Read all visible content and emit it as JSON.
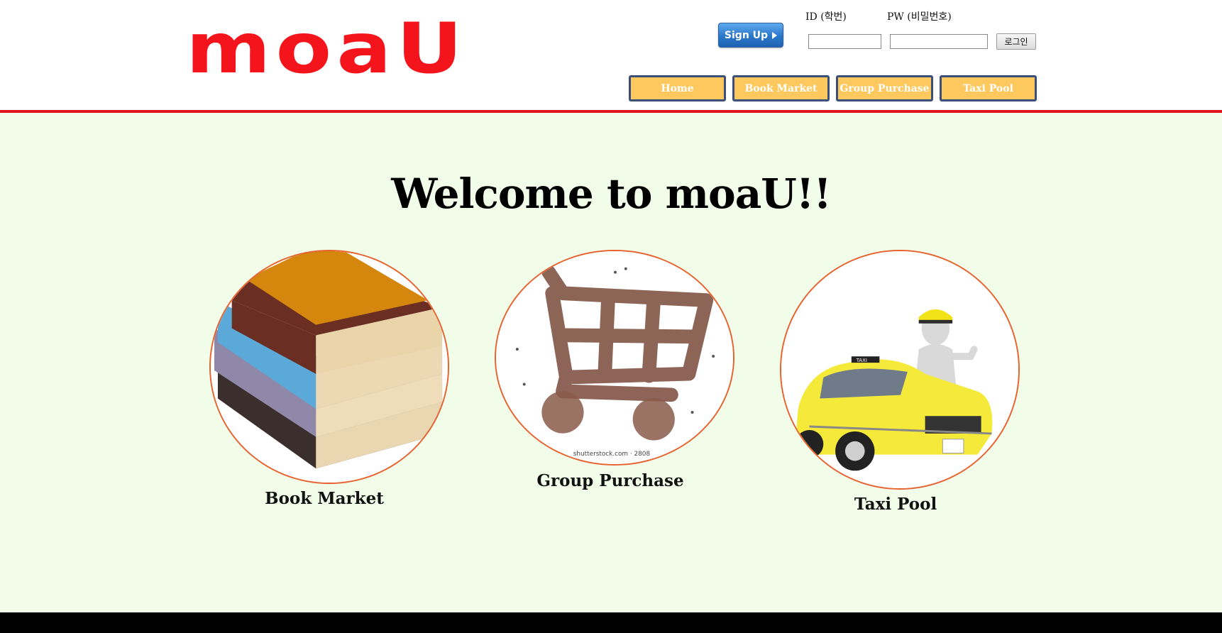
{
  "header": {
    "logo_text": "moaU",
    "signup_label": "Sign Up",
    "id_label": "ID (학번)",
    "pw_label": "PW (비밀번호)",
    "id_value": "",
    "pw_value": "",
    "login_label": "로그인"
  },
  "nav": {
    "items": [
      {
        "label": "Home"
      },
      {
        "label": "Book Market"
      },
      {
        "label": "Group Purchase"
      },
      {
        "label": "Taxi Pool"
      }
    ]
  },
  "main": {
    "welcome": "Welcome to moaU!!",
    "cards": [
      {
        "label": "Book Market",
        "image": "books-image"
      },
      {
        "label": "Group Purchase",
        "image": "crowd-shopping-cart-image",
        "watermark": "shutterstock.com · 2808"
      },
      {
        "label": "Taxi Pool",
        "image": "taxi-driver-image"
      }
    ]
  },
  "colors": {
    "brand_red": "#f4141b",
    "nav_fill": "#fdc95e",
    "nav_border": "#3b4f78",
    "main_bg": "#f1fde8",
    "circle_border": "#e8622f"
  }
}
